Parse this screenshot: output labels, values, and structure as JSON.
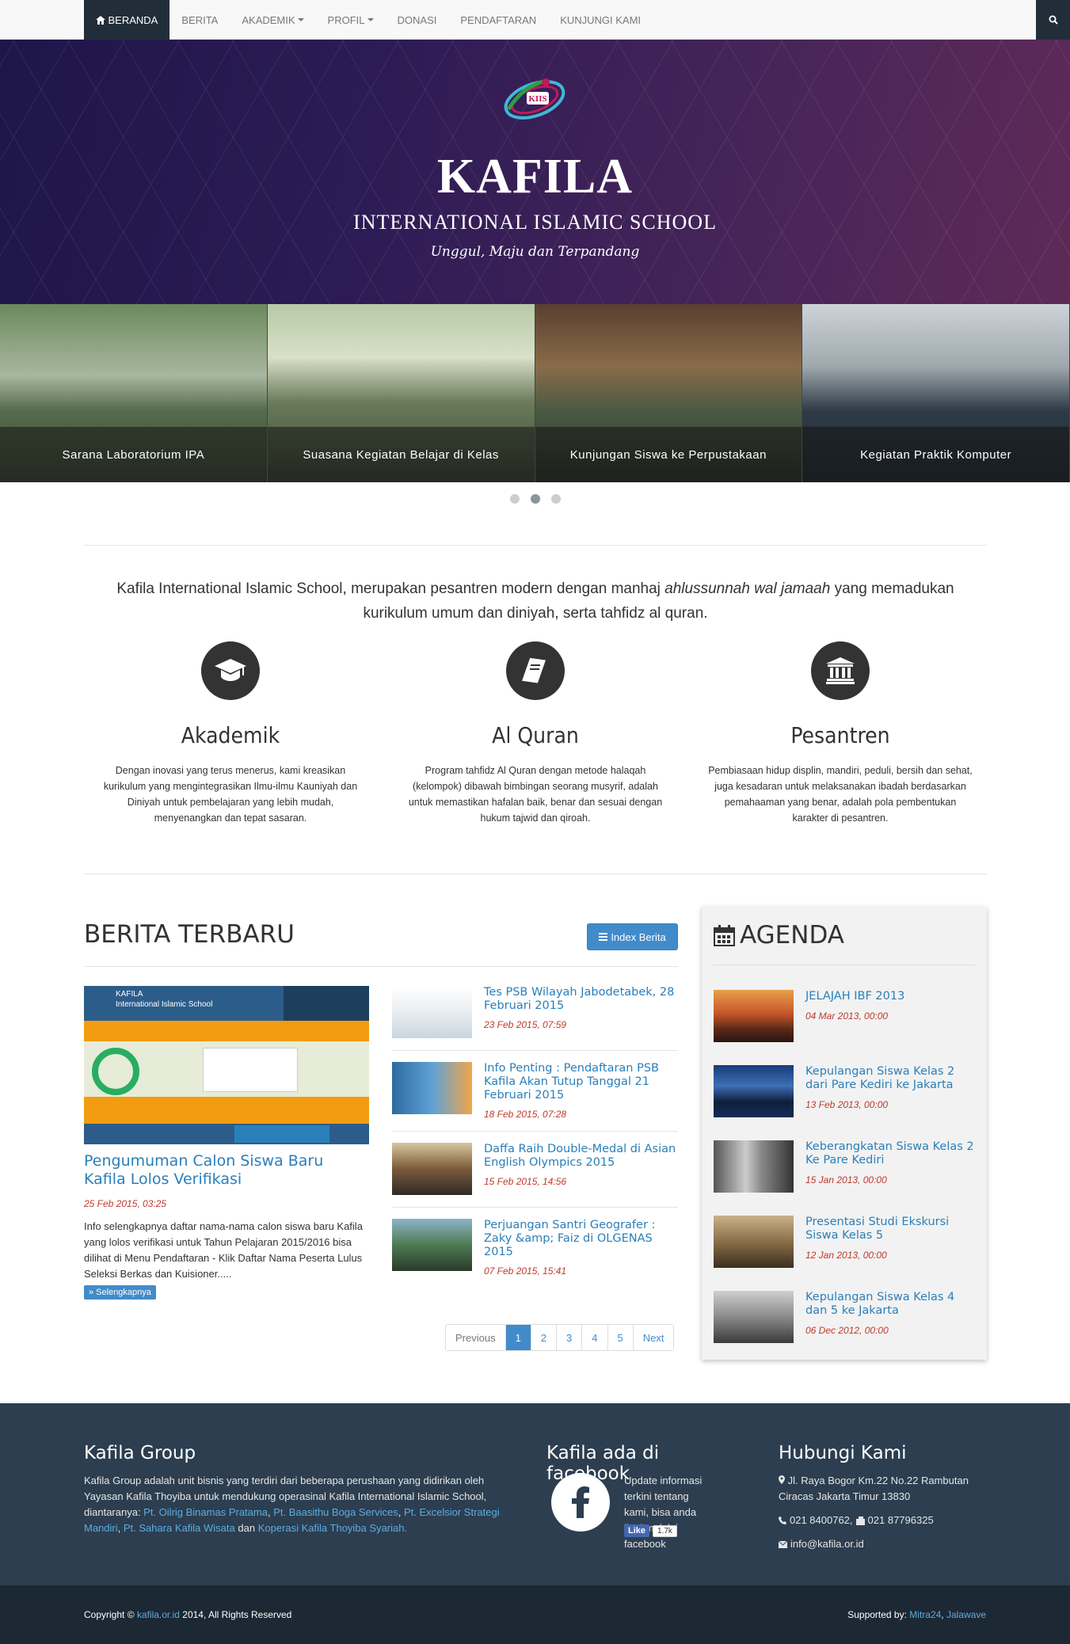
{
  "nav": {
    "items": [
      {
        "label": "BERANDA",
        "active": true,
        "icon": "home-icon"
      },
      {
        "label": "BERITA"
      },
      {
        "label": "AKADEMIK",
        "dropdown": true
      },
      {
        "label": "PROFIL",
        "dropdown": true
      },
      {
        "label": "DONASI"
      },
      {
        "label": "PENDAFTARAN"
      },
      {
        "label": "KUNJUNGI KAMI"
      }
    ],
    "search_icon": "search-icon"
  },
  "hero": {
    "logo_text": "KIIS",
    "title": "KAFILA",
    "subtitle": "INTERNATIONAL ISLAMIC SCHOOL",
    "tagline": "Unggul, Maju dan Terpandang"
  },
  "slider": {
    "slides": [
      {
        "caption": "Sarana Laboratorium IPA"
      },
      {
        "caption": "Suasana Kegiatan Belajar di Kelas"
      },
      {
        "caption": "Kunjungan Siswa ke Perpustakaan"
      },
      {
        "caption": "Kegiatan Praktik Komputer"
      }
    ],
    "dots": 3,
    "active_dot": 1
  },
  "intro": {
    "part1": "Kafila International Islamic School, merupakan pesantren modern dengan manhaj ",
    "emphasis": "ahlussunnah wal jamaah",
    "part2": " yang memadukan kurikulum umum dan diniyah, serta tahfidz al quran."
  },
  "features": [
    {
      "icon": "graduation-cap-icon",
      "title": "Akademik",
      "desc": "Dengan inovasi yang terus menerus, kami kreasikan kurikulum yang mengintegrasikan Ilmu-ilmu Kauniyah dan Diniyah untuk pembelajaran yang lebih mudah, menyenangkan dan tepat sasaran."
    },
    {
      "icon": "book-icon",
      "title": "Al Quran",
      "desc": "Program tahfidz Al Quran dengan metode halaqah (kelompok) dibawah bimbingan seorang musyrif, adalah untuk memastikan hafalan baik, benar dan sesuai dengan hukum tajwid dan qiroah."
    },
    {
      "icon": "institution-icon",
      "title": "Pesantren",
      "desc": "Pembiasaan hidup displin, mandiri, peduli, bersih dan sehat, juga kesadaran untuk melaksanakan ibadah berdasarkan pemahaaman yang benar, adalah pola pembentukan karakter di pesantren."
    }
  ],
  "news": {
    "title": "BERITA TERBARU",
    "index_button": "Index Berita",
    "featured": {
      "title": "Pengumuman Calon Siswa Baru Kafila Lolos Verifikasi",
      "date": "25 Feb 2015, 03:25",
      "desc": "Info selengkapnya daftar nama-nama calon siswa baru Kafila yang lolos verifikasi untuk Tahun Pelajaran 2015/2016 bisa dilihat di Menu Pendaftaran - Klik Daftar Nama Peserta Lulus Seleksi Berkas dan Kuisioner.....",
      "more": "» Selengkapnya",
      "img_heading": "KAFILA",
      "img_sub": "International Islamic School"
    },
    "items": [
      {
        "title": "Tes PSB Wilayah Jabodetabek, 28 Februari 2015",
        "date": "23 Feb 2015, 07:59"
      },
      {
        "title": "Info Penting : Pendaftaran PSB Kafila Akan Tutup Tanggal 21 Februari 2015",
        "date": "18 Feb 2015, 07:28"
      },
      {
        "title": "Daffa Raih Double-Medal di Asian English Olympics 2015",
        "date": "15 Feb 2015, 14:56"
      },
      {
        "title": "Perjuangan Santri Geografer : Zaky &amp; Faiz di OLGENAS 2015",
        "date": "07 Feb 2015, 15:41"
      }
    ],
    "pager": [
      "Previous",
      "1",
      "2",
      "3",
      "4",
      "5",
      "Next"
    ],
    "pager_active": "1"
  },
  "agenda": {
    "title": "AGENDA",
    "items": [
      {
        "title": "JELAJAH IBF 2013",
        "date": "04 Mar 2013, 00:00"
      },
      {
        "title": "Kepulangan Siswa Kelas 2 dari Pare Kediri ke Jakarta",
        "date": "13 Feb 2013, 00:00"
      },
      {
        "title": "Keberangkatan Siswa Kelas 2 Ke Pare Kediri",
        "date": "15 Jan 2013, 00:00"
      },
      {
        "title": "Presentasi Studi Ekskursi Siswa Kelas 5",
        "date": "12 Jan 2013, 00:00"
      },
      {
        "title": "Kepulangan Siswa Kelas 4 dan 5 ke Jakarta",
        "date": "06 Dec 2012, 00:00"
      }
    ]
  },
  "footer": {
    "group_title": "Kafila Group",
    "group_text": "Kafila Group adalah unit bisnis yang terdiri dari beberapa perushaan yang didirikan oleh Yayasan Kafila Thoyiba untuk mendukung operasinal Kafila International Islamic School, diantaranya: ",
    "links": [
      "Pt. Oilrig Binamas Pratama",
      "Pt. Baasithu Boga Services",
      "Pt. Excelsior Strategi Mandiri",
      "Pt. Sahara Kafila Wisata",
      "Koperasi Kafila Thoyiba Syariah."
    ],
    "and": "dan",
    "fb_title": "Kafila ada di facebook",
    "fb_text": "Update informasi terkini tentang kami, bisa anda ikuti melalui facebook",
    "fb_like": "Like",
    "fb_count": "1.7k",
    "contact_title": "Hubungi Kami",
    "address": "Jl. Raya Bogor Km.22 No.22 Rambutan Ciracas Jakarta Timur 13830",
    "phone": "021 8400762,",
    "fax": "021 87796325",
    "email": "info@kafila.or.id",
    "copyright_pre": "Copyright ©",
    "copyright_link": "kafila.or.id",
    "copyright_post": "2014, All Rights Reserved",
    "supported_label": "Supported by:",
    "supported_links": [
      "Mitra24",
      "Jalawave"
    ]
  },
  "colors": {
    "nav_active": "#222d3a",
    "link": "#2a7fba",
    "date": "#c0392b",
    "primary": "#428bca",
    "footer": "#2c3e50"
  }
}
